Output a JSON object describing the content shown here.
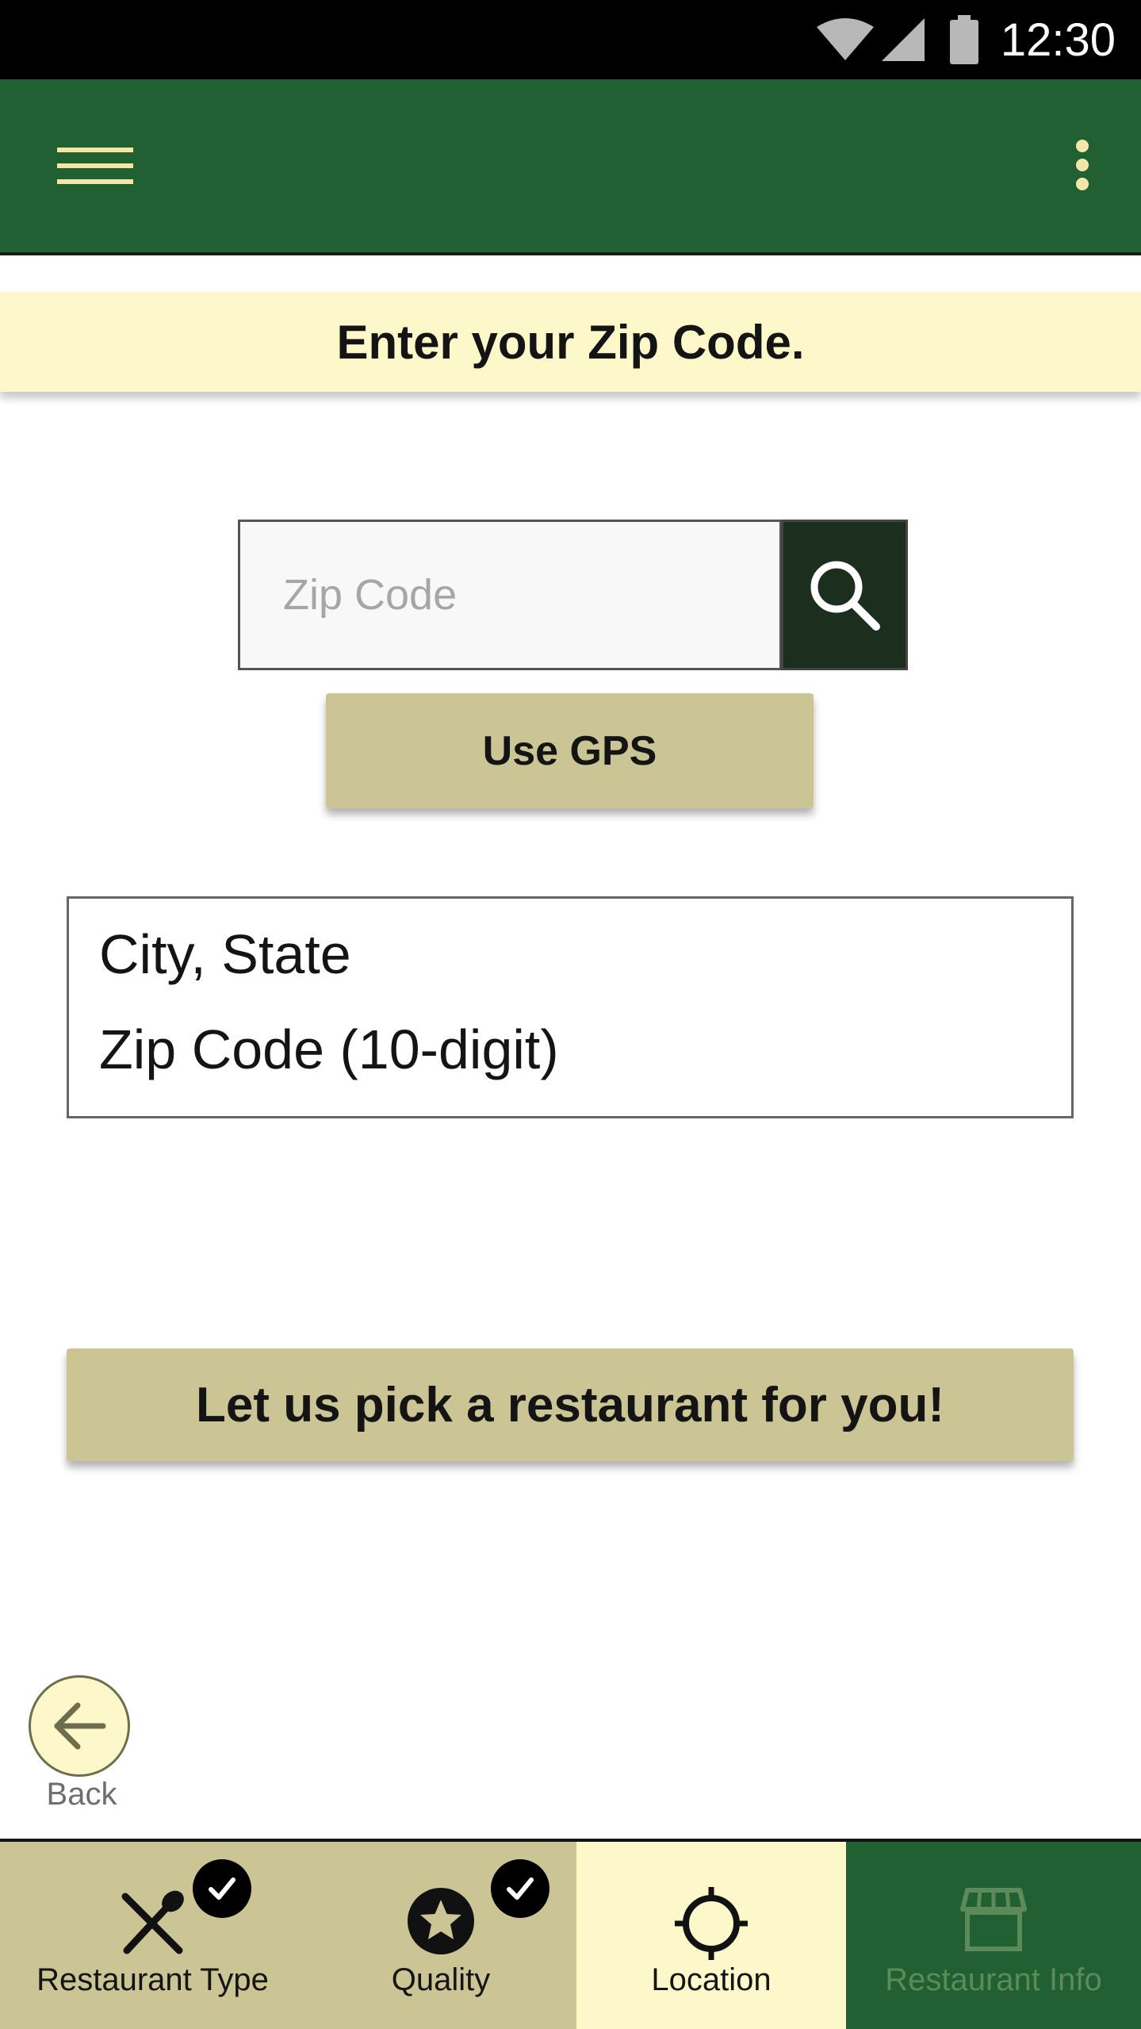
{
  "status_bar": {
    "time": "12:30",
    "icons": [
      "wifi-icon",
      "signal-icon",
      "battery-icon"
    ]
  },
  "app_bar": {
    "menu_icon": "hamburger-menu-icon",
    "overflow_icon": "more-vert-icon",
    "color": "#206032"
  },
  "prompt": {
    "text": "Enter your Zip Code."
  },
  "zip_search": {
    "placeholder": "Zip Code",
    "value": "",
    "search_icon": "search-icon"
  },
  "gps_button": {
    "label": "Use GPS"
  },
  "location_result": {
    "line1": "City, State",
    "line2": "Zip Code (10-digit)"
  },
  "pick_button": {
    "label": "Let us pick a restaurant for you!"
  },
  "back": {
    "label": "Back",
    "icon": "arrow-left-icon"
  },
  "bottom_nav": {
    "items": [
      {
        "label": "Restaurant Type",
        "icon": "utensils-icon",
        "completed": true
      },
      {
        "label": "Quality",
        "icon": "star-icon",
        "completed": true
      },
      {
        "label": "Location",
        "icon": "location-target-icon",
        "active": true
      },
      {
        "label": "Restaurant Info",
        "icon": "storefront-icon",
        "disabled": true
      }
    ]
  },
  "colors": {
    "primary_green": "#206032",
    "cream": "#fdf8c9",
    "khaki": "#cbc595",
    "dark_search": "#1c2e1d"
  }
}
